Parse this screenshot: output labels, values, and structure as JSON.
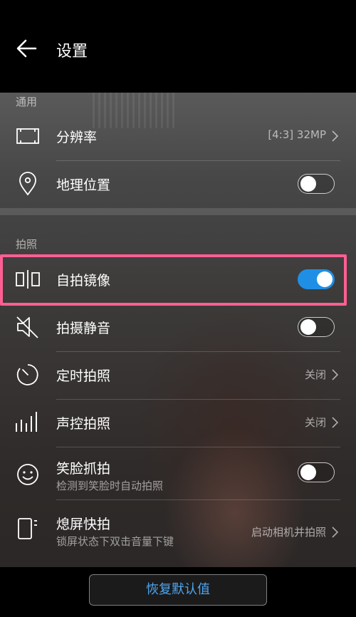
{
  "header": {
    "title": "设置"
  },
  "sections": {
    "general": "通用",
    "photo": "拍照"
  },
  "rows": {
    "resolution": {
      "label": "分辨率",
      "value": "[4:3] 32MP"
    },
    "location": {
      "label": "地理位置",
      "toggle": false
    },
    "mirror": {
      "label": "自拍镜像",
      "toggle": true
    },
    "mute": {
      "label": "拍摄静音",
      "toggle": false
    },
    "timer": {
      "label": "定时拍照",
      "value": "关闭"
    },
    "voice": {
      "label": "声控拍照",
      "value": "关闭"
    },
    "smile": {
      "label": "笑脸抓拍",
      "sub": "检测到笑脸时自动拍照",
      "toggle": false
    },
    "ultra": {
      "label": "熄屏快拍",
      "sub": "锁屏状态下双击音量下键",
      "value": "启动相机并拍照"
    }
  },
  "footer": {
    "reset_label": "恢复默认值"
  },
  "colors": {
    "accent": "#1f8fe6",
    "highlight": "#ff5f93",
    "reset_text": "#4fa6f0"
  }
}
